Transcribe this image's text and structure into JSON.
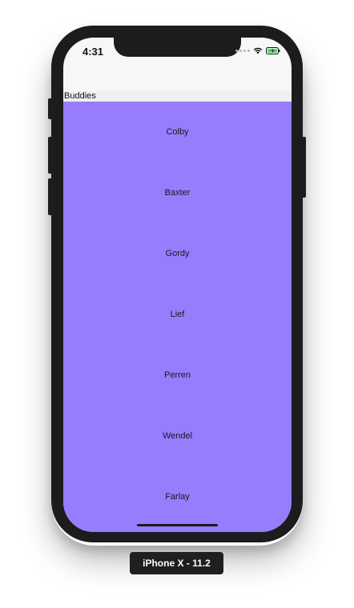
{
  "status_bar": {
    "time": "4:31",
    "icons": [
      "signal-dots-icon",
      "wifi-icon",
      "battery-charging-icon"
    ]
  },
  "list": {
    "title": "Buddies",
    "background_color": "#977cfe",
    "items": [
      {
        "label": "Colby"
      },
      {
        "label": "Baxter"
      },
      {
        "label": "Gordy"
      },
      {
        "label": "Lief"
      },
      {
        "label": "Perren"
      },
      {
        "label": "Wendel"
      },
      {
        "label": "Farlay"
      }
    ]
  },
  "device": {
    "label": "iPhone X - 11.2"
  }
}
